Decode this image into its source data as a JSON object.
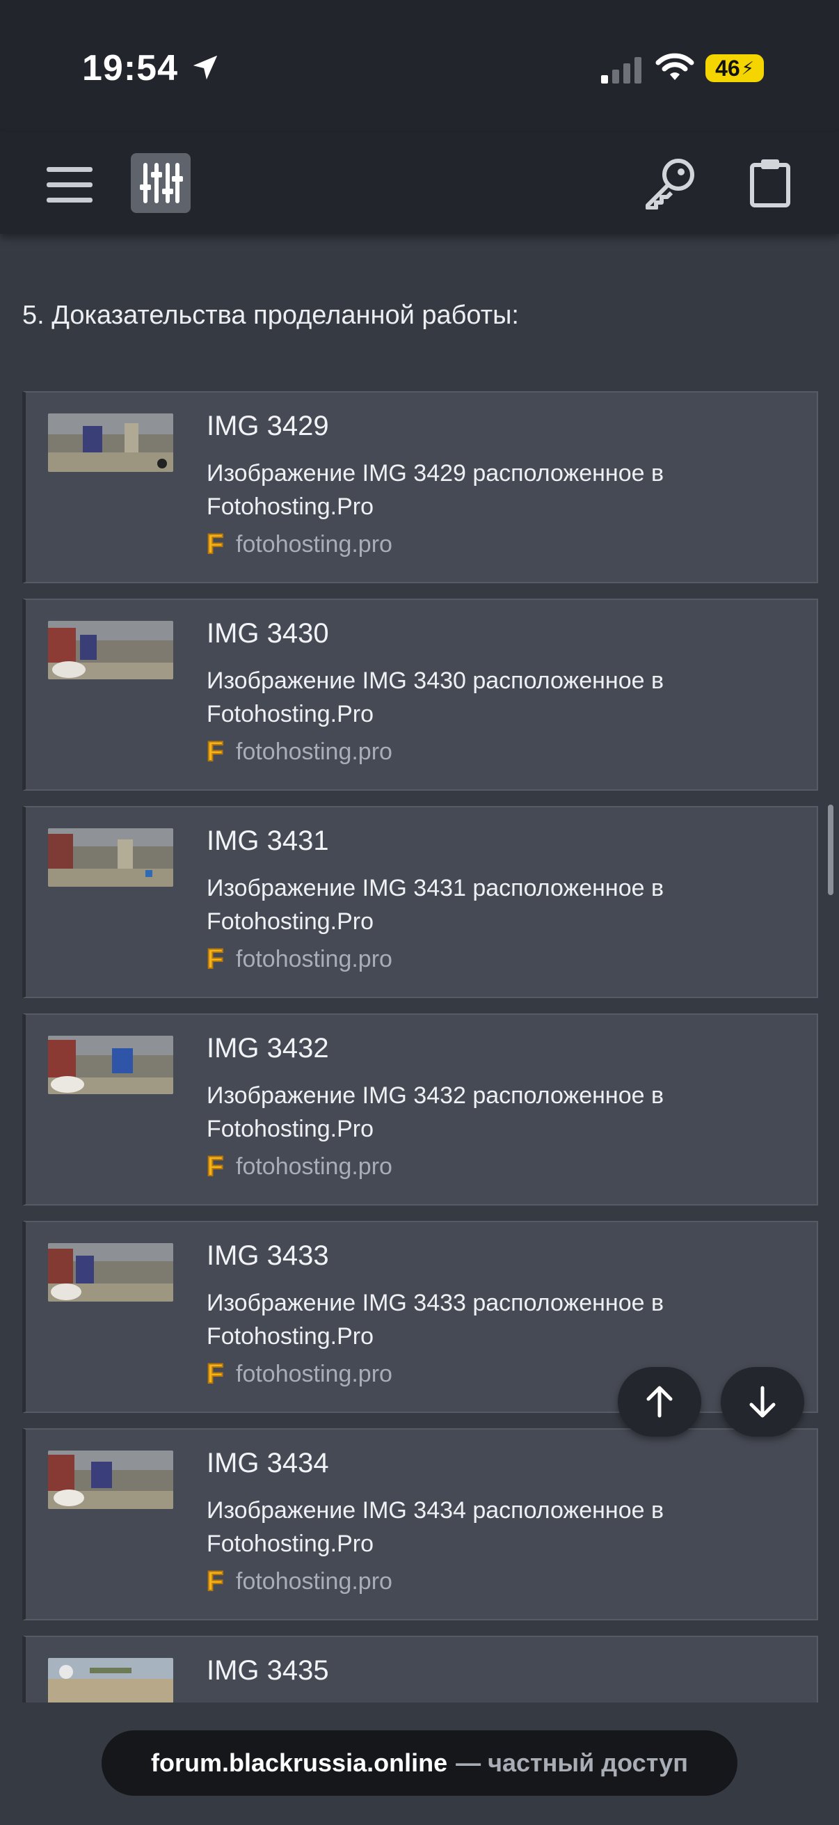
{
  "status_bar": {
    "time": "19:54",
    "battery": "46",
    "icons": [
      "location-arrow-icon",
      "signal-icon",
      "wifi-icon",
      "battery-charging-icon"
    ]
  },
  "toolbar": {
    "icons": [
      "menu-icon",
      "filter-sliders-icon",
      "key-icon",
      "clipboard-icon"
    ]
  },
  "section_heading": "5. Доказательства проделанной работы:",
  "cards": [
    {
      "title": "IMG 3429",
      "desc": "Изображение IMG 3429 расположенное в Fotohosting.Pro",
      "source": "fotohosting.pro"
    },
    {
      "title": "IMG 3430",
      "desc": "Изображение IMG 3430 расположенное в Fotohosting.Pro",
      "source": "fotohosting.pro"
    },
    {
      "title": "IMG 3431",
      "desc": "Изображение IMG 3431 расположенное в Fotohosting.Pro",
      "source": "fotohosting.pro"
    },
    {
      "title": "IMG 3432",
      "desc": "Изображение IMG 3432 расположенное в Fotohosting.Pro",
      "source": "fotohosting.pro"
    },
    {
      "title": "IMG 3433",
      "desc": "Изображение IMG 3433 расположенное в Fotohosting.Pro",
      "source": "fotohosting.pro"
    },
    {
      "title": "IMG 3434",
      "desc": "Изображение IMG 3434 расположенное в Fotohosting.Pro",
      "source": "fotohosting.pro"
    },
    {
      "title": "IMG 3435",
      "desc": "",
      "source": ""
    }
  ],
  "fabs": {
    "up_icon": "arrow-up-icon",
    "down_icon": "arrow-down-icon"
  },
  "address_bar": {
    "host": "forum.blackrussia.online",
    "suffix": "— частный доступ"
  },
  "colors": {
    "page_bg": "#363a42",
    "toolbar_bg": "#22252c",
    "card_bg": "#464a54",
    "accent_f": "#f6b21b",
    "battery": "#f4d500"
  }
}
